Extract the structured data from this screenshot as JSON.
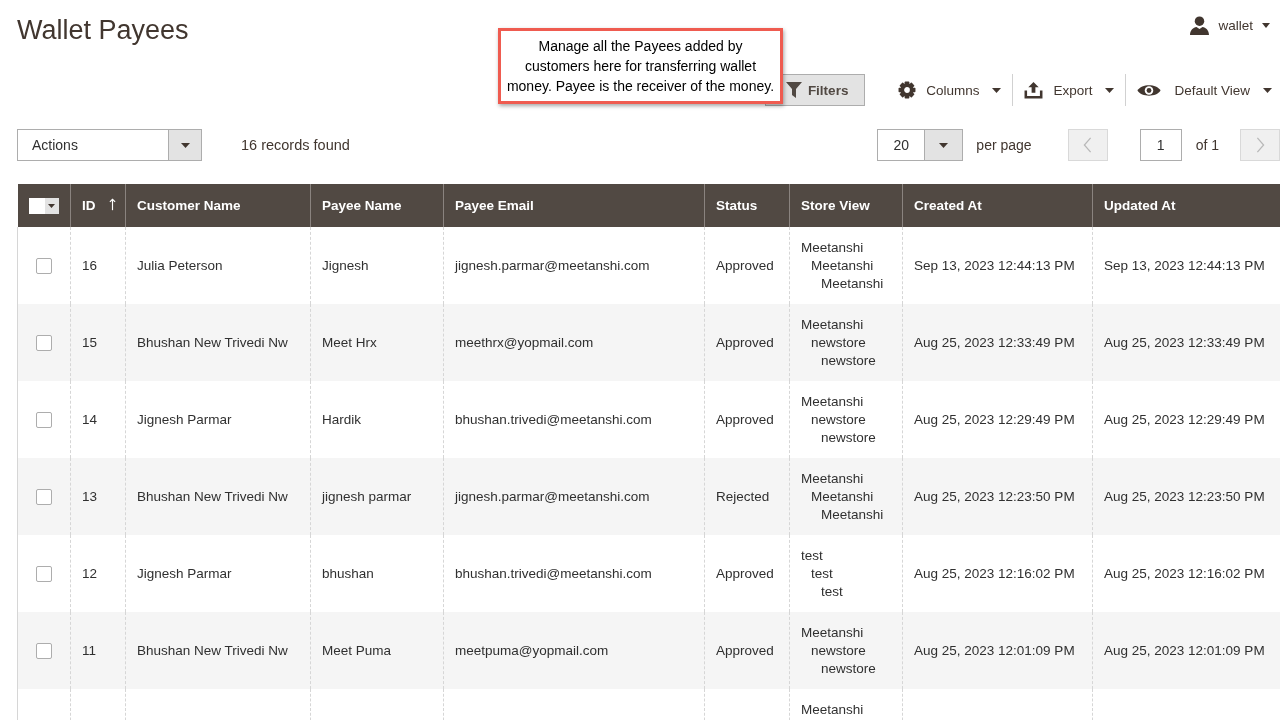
{
  "page_title": "Wallet Payees",
  "user_menu": {
    "label": "wallet"
  },
  "callout": {
    "text": "Manage all the Payees added by customers here for transferring wallet money. Payee is the receiver of the money."
  },
  "toolbar": {
    "filters": "Filters",
    "menus": [
      {
        "kind": "columns",
        "label": "Columns"
      },
      {
        "kind": "export",
        "label": "Export"
      },
      {
        "kind": "view",
        "label": "Default View"
      }
    ]
  },
  "actions": {
    "label": "Actions"
  },
  "records": "16 records found",
  "pager": {
    "per_page": "20",
    "per_page_label": "per page",
    "prev": {
      "disabled": true
    },
    "page": "1",
    "total": "of 1",
    "next": {
      "disabled": true
    }
  },
  "table": {
    "mass_select": {
      "checked": false
    },
    "columns": [
      {
        "label": "ID",
        "sorted": true
      },
      {
        "label": "Customer Name",
        "sorted": false
      },
      {
        "label": "Payee Name",
        "sorted": false
      },
      {
        "label": "Payee Email",
        "sorted": false
      },
      {
        "label": "Status",
        "sorted": false
      },
      {
        "label": "Store View",
        "sorted": false
      },
      {
        "label": "Created At",
        "sorted": false
      },
      {
        "label": "Updated At",
        "sorted": false
      }
    ],
    "rows": [
      {
        "checked": false,
        "id": "16",
        "customer_name": "Julia Peterson",
        "payee_name": "Jignesh",
        "payee_email": "jignesh.parmar@meetanshi.com",
        "status": "Approved",
        "store_view": [
          {
            "name": "Meetanshi",
            "children": [
              {
                "name": "Meetanshi",
                "children": [
                  {
                    "name": "Meetanshi"
                  }
                ]
              }
            ]
          }
        ],
        "created_at": "Sep 13, 2023 12:44:13 PM",
        "updated_at": "Sep 13, 2023 12:44:13 PM"
      },
      {
        "checked": false,
        "id": "15",
        "customer_name": "Bhushan New Trivedi Nw",
        "payee_name": "Meet Hrx",
        "payee_email": "meethrx@yopmail.com",
        "status": "Approved",
        "store_view": [
          {
            "name": "Meetanshi",
            "children": [
              {
                "name": "newstore",
                "children": [
                  {
                    "name": "newstore"
                  }
                ]
              }
            ]
          }
        ],
        "created_at": "Aug 25, 2023 12:33:49 PM",
        "updated_at": "Aug 25, 2023 12:33:49 PM"
      },
      {
        "checked": false,
        "id": "14",
        "customer_name": "Jignesh Parmar",
        "payee_name": "Hardik",
        "payee_email": "bhushan.trivedi@meetanshi.com",
        "status": "Approved",
        "store_view": [
          {
            "name": "Meetanshi",
            "children": [
              {
                "name": "newstore",
                "children": [
                  {
                    "name": "newstore"
                  }
                ]
              }
            ]
          }
        ],
        "created_at": "Aug 25, 2023 12:29:49 PM",
        "updated_at": "Aug 25, 2023 12:29:49 PM"
      },
      {
        "checked": false,
        "id": "13",
        "customer_name": "Bhushan New Trivedi Nw",
        "payee_name": "jignesh parmar",
        "payee_email": "jignesh.parmar@meetanshi.com",
        "status": "Rejected",
        "store_view": [
          {
            "name": "Meetanshi",
            "children": [
              {
                "name": "Meetanshi",
                "children": [
                  {
                    "name": "Meetanshi"
                  }
                ]
              }
            ]
          }
        ],
        "created_at": "Aug 25, 2023 12:23:50 PM",
        "updated_at": "Aug 25, 2023 12:23:50 PM"
      },
      {
        "checked": false,
        "id": "12",
        "customer_name": "Jignesh Parmar",
        "payee_name": "bhushan",
        "payee_email": "bhushan.trivedi@meetanshi.com",
        "status": "Approved",
        "store_view": [
          {
            "name": "test",
            "children": [
              {
                "name": "test",
                "children": [
                  {
                    "name": "test"
                  }
                ]
              }
            ]
          }
        ],
        "created_at": "Aug 25, 2023 12:16:02 PM",
        "updated_at": "Aug 25, 2023 12:16:02 PM"
      },
      {
        "checked": false,
        "id": "11",
        "customer_name": "Bhushan New Trivedi Nw",
        "payee_name": "Meet Puma",
        "payee_email": "meetpuma@yopmail.com",
        "status": "Approved",
        "store_view": [
          {
            "name": "Meetanshi",
            "children": [
              {
                "name": "newstore",
                "children": [
                  {
                    "name": "newstore"
                  }
                ]
              }
            ]
          }
        ],
        "created_at": "Aug 25, 2023 12:01:09 PM",
        "updated_at": "Aug 25, 2023 12:01:09 PM"
      },
      {
        "store_view": [
          {
            "name": "Meetanshi"
          }
        ]
      }
    ]
  }
}
